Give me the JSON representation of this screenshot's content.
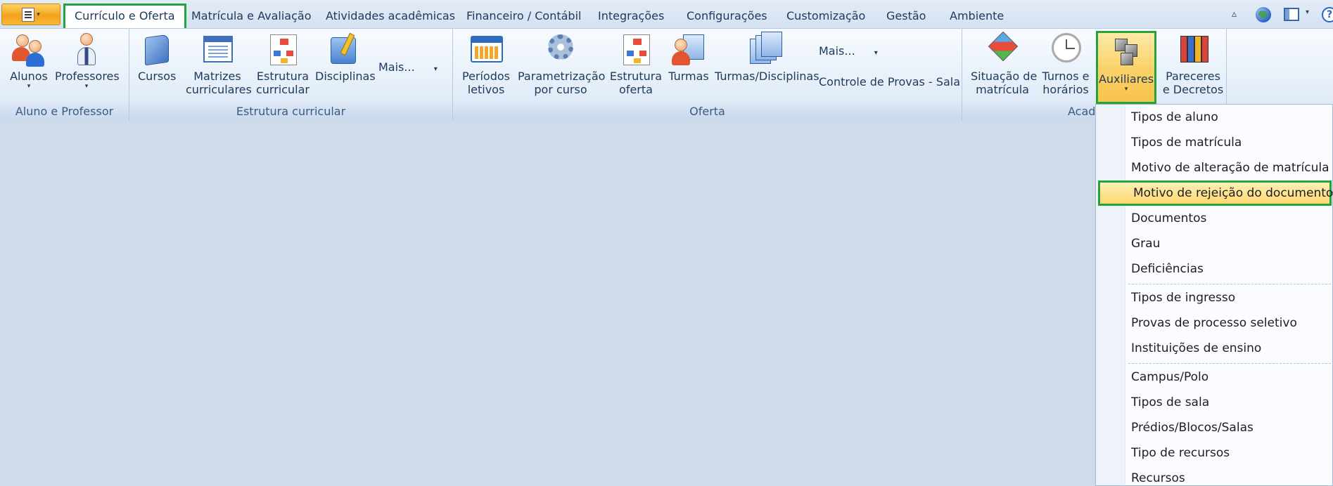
{
  "tabs": [
    {
      "label": "Currículo e Oferta",
      "active": true
    },
    {
      "label": "Matrícula e Avaliação"
    },
    {
      "label": "Atividades acadêmicas"
    },
    {
      "label": "Financeiro / Contábil"
    },
    {
      "label": "Integrações"
    },
    {
      "label": "Configurações"
    },
    {
      "label": "Customização"
    },
    {
      "label": "Gestão"
    },
    {
      "label": "Ambiente"
    }
  ],
  "groups": {
    "aluno_professor": {
      "label": "Aluno e Professor",
      "alunos": "Alunos",
      "professores": "Professores"
    },
    "estrutura": {
      "label": "Estrutura curricular",
      "cursos": "Cursos",
      "matrizes_1": "Matrizes",
      "matrizes_2": "curriculares",
      "estrutura_1": "Estrutura",
      "estrutura_2": "curricular",
      "disciplinas": "Disciplinas",
      "mais": "Mais..."
    },
    "oferta": {
      "label": "Oferta",
      "periodos_1": "Períodos",
      "periodos_2": "letivos",
      "param_1": "Parametrização",
      "param_2": "por curso",
      "estr_oferta_1": "Estrutura",
      "estr_oferta_2": "oferta",
      "turmas": "Turmas",
      "turmas_disc": "Turmas/Disciplinas",
      "mais": "Mais...",
      "controle_provas": "Controle de Provas - Sala"
    },
    "academico": {
      "label": "Acad",
      "situacao_1": "Situação de",
      "situacao_2": "matrícula",
      "turnos_1": "Turnos e",
      "turnos_2": "horários",
      "auxiliares": "Auxiliares",
      "pareceres_1": "Pareceres",
      "pareceres_2": "e Decretos"
    }
  },
  "menu": {
    "items": [
      "Tipos de aluno",
      "Tipos de matrícula",
      "Motivo de alteração de matrícula",
      "Motivo de rejeição do documento",
      "Documentos",
      "Grau",
      "Deficiências",
      "Tipos de ingresso",
      "Provas de processo seletivo",
      "Instituições de ensino",
      "Campus/Polo",
      "Tipos de sala",
      "Prédios/Blocos/Salas",
      "Tipo de recursos",
      "Recursos"
    ],
    "highlighted": "Motivo de rejeição do documento"
  },
  "colors": {
    "accent_highlight": "#24a23c",
    "menu_highlight": "#fbd86f",
    "background": "#cfdbea"
  }
}
